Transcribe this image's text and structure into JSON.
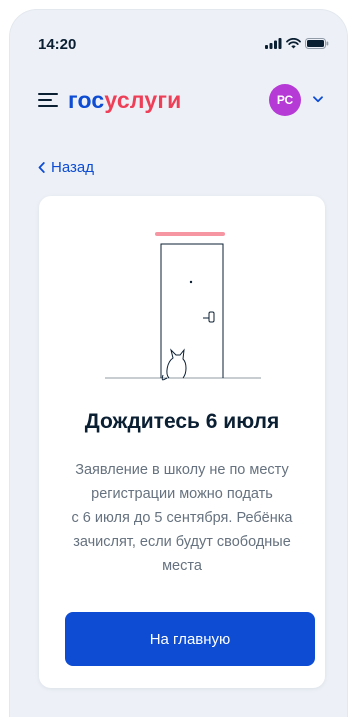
{
  "status_bar": {
    "time": "14:20"
  },
  "header": {
    "logo_part1": "гос",
    "logo_part2": "услуги",
    "avatar_initials": "РС",
    "brand_blue": "#0d4cd3",
    "brand_red": "#ee3f58",
    "avatar_color": "#b53ad6"
  },
  "nav": {
    "back_label": "Назад"
  },
  "card": {
    "title": "Дождитесь 6 июля",
    "description_lines": [
      "Заявление в школу не по месту",
      "регистрации можно подать",
      "с 6 июля до 5 сентября. Ребёнка",
      "зачислят, если будут свободные",
      "места"
    ],
    "button_label": "На главную"
  }
}
